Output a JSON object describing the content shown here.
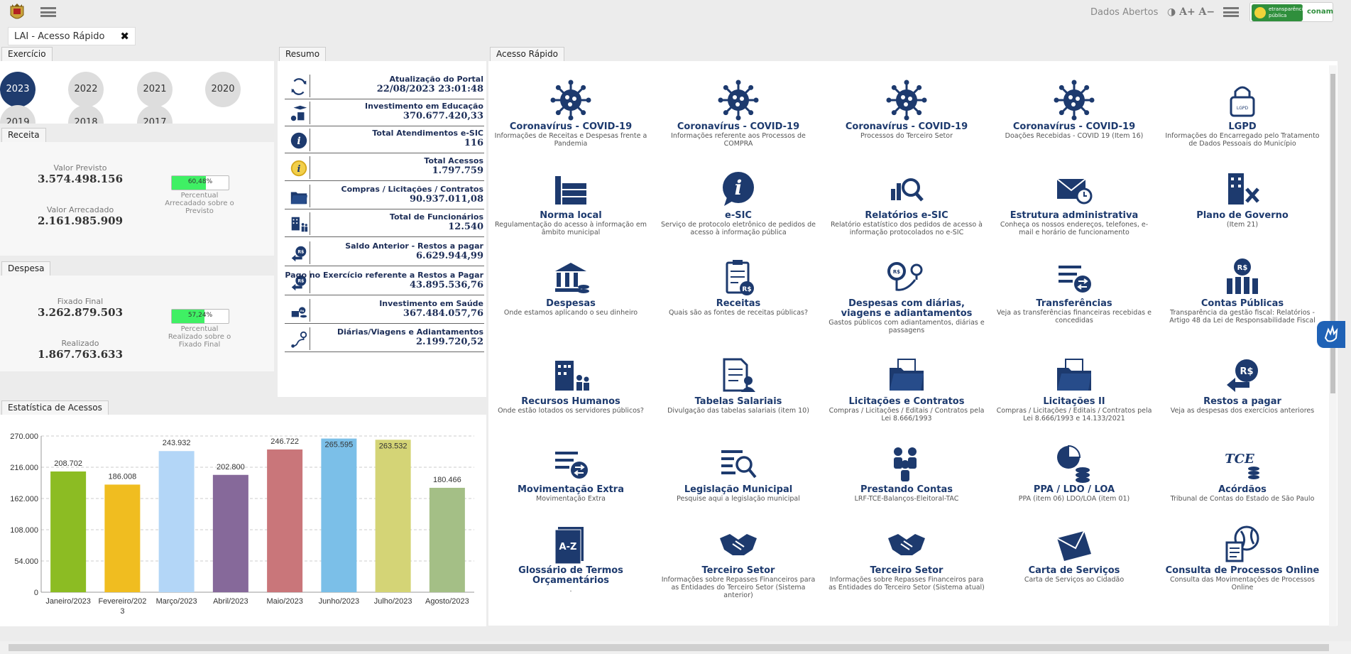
{
  "header": {
    "dados_abertos": "Dados Abertos",
    "font_controls": "◑ A+ A−",
    "brand_text": "etransparência pública",
    "brand_company": "conam"
  },
  "open_tab": {
    "label": "LAI - Acesso Rápido",
    "close": "✖"
  },
  "exercicio": {
    "tab": "Exercício",
    "years": [
      "2023",
      "2022",
      "2021",
      "2020",
      "2019",
      "2018",
      "2017"
    ],
    "selected": "2023"
  },
  "receita": {
    "tab": "Receita",
    "previsto_label": "Valor Previsto",
    "previsto_value": "3.574.498.156",
    "arrecadado_label": "Valor Arrecadado",
    "arrecadado_value": "2.161.985.909",
    "percent_text": "60,48%",
    "percent_value": 60.48,
    "percent_note": "Percentual Arrecadado sobre o Previsto"
  },
  "despesa": {
    "tab": "Despesa",
    "fixado_label": "Fixado Final",
    "fixado_value": "3.262.879.503",
    "realizado_label": "Realizado",
    "realizado_value": "1.867.763.633",
    "percent_text": "57,24%",
    "percent_value": 57.24,
    "percent_note": "Percentual Realizado sobre o Fixado Final"
  },
  "resumo": {
    "tab": "Resumo",
    "rows": [
      {
        "label": "Atualização do Portal",
        "value": "22/08/2023 23:01:48",
        "icon": "refresh-icon"
      },
      {
        "label": "Investimento em Educação",
        "value": "370.677.420,33",
        "icon": "education-icon"
      },
      {
        "label": "Total Atendimentos e-SIC",
        "value": "116",
        "icon": "info-icon"
      },
      {
        "label": "Total Acessos",
        "value": "1.797.759",
        "icon": "info-yellow-icon"
      },
      {
        "label": "Compras / Licitações / Contratos",
        "value": "90.937.011,08",
        "icon": "folder-icon"
      },
      {
        "label": "Total de Funcionários",
        "value": "12.540",
        "icon": "staff-icon"
      },
      {
        "label": "Saldo Anterior - Restos a pagar",
        "value": "6.629.944,99",
        "icon": "money-back-icon"
      },
      {
        "label": "Pago no Exercício referente a Restos a Pagar",
        "value": "43.895.536,76",
        "icon": "money-back-icon"
      },
      {
        "label": "Investimento em Saúde",
        "value": "367.484.057,76",
        "icon": "health-money-icon"
      },
      {
        "label": "Diárias/Viagens e Adiantamentos",
        "value": "2.199.720,52",
        "icon": "route-icon"
      }
    ]
  },
  "acesso_rapido": {
    "tab": "Acesso Rápido",
    "items": [
      {
        "title": "Coronavírus - COVID-19",
        "desc": "Informações de Receitas e Despesas frente a Pandemia",
        "icon": "virus-icon"
      },
      {
        "title": "Coronavírus - COVID-19",
        "desc": "Informações referente aos Processos de COMPRA",
        "icon": "virus-icon"
      },
      {
        "title": "Coronavírus - COVID-19",
        "desc": "Processos do Terceiro Setor",
        "icon": "virus-icon"
      },
      {
        "title": "Coronavírus - COVID-19",
        "desc": "Doações Recebidas - COVID 19 (Item 16)",
        "icon": "virus-icon"
      },
      {
        "title": "LGPD",
        "desc": "Informações do Encarregado pelo Tratamento de Dados Pessoais do Município",
        "icon": "lock-icon"
      },
      {
        "title": "Norma local",
        "desc": "Regulamentação do acesso à informação em âmbito municipal",
        "icon": "books-icon"
      },
      {
        "title": "e-SIC",
        "desc": "Serviço de protocolo eletrônico de pedidos de acesso à informação pública",
        "icon": "info-bubble-icon"
      },
      {
        "title": "Relatórios e-SIC",
        "desc": "Relatório estatístico dos pedidos de acesso à informação protocolados no e-SIC",
        "icon": "chart-search-icon"
      },
      {
        "title": "Estrutura administrativa",
        "desc": "Conheça os nossos endereços, telefones, e-mail e horário de funcionamento",
        "icon": "mail-clock-icon"
      },
      {
        "title": "Plano de Governo",
        "desc": "(Item 21)",
        "icon": "building-tools-icon"
      },
      {
        "title": "Despesas",
        "desc": "Onde estamos aplicando o seu dinheiro",
        "icon": "bank-coins-icon"
      },
      {
        "title": "Receitas",
        "desc": "Quais são as fontes de receitas públicas?",
        "icon": "clipboard-money-icon"
      },
      {
        "title": "Despesas com diárias, viagens e adiantamentos",
        "desc": "Gastos públicos com adiantamentos, diárias e passagens",
        "icon": "route-money-icon"
      },
      {
        "title": "Transferências",
        "desc": "Veja as transferências financeiras recebidas e concedidas",
        "icon": "list-transfer-icon"
      },
      {
        "title": "Contas Públicas",
        "desc": "Transparência da gestão fiscal: Relatórios - Artigo 48 da Lei de Responsabilidade Fiscal",
        "icon": "money-bars-icon"
      },
      {
        "title": "Recursos Humanos",
        "desc": "Onde estão lotados os servidores públicos?",
        "icon": "building-people-icon"
      },
      {
        "title": "Tabelas Salariais",
        "desc": "Divulgação das tabelas salariais (item 10)",
        "icon": "document-person-icon"
      },
      {
        "title": "Licitações e Contratos",
        "desc": "Compras / Licitações / Editais / Contratos pela Lei 8.666/1993",
        "icon": "folder-docs-icon"
      },
      {
        "title": "Licitações II",
        "desc": "Compras / Licitações / Editais / Contratos pela Lei 8.666/1993 e 14.133/2021",
        "icon": "folder-docs-icon"
      },
      {
        "title": "Restos a pagar",
        "desc": "Veja as despesas dos exercícios anteriores",
        "icon": "money-back-icon"
      },
      {
        "title": "Movimentação Extra",
        "desc": "Movimentação Extra",
        "icon": "list-transfer-icon"
      },
      {
        "title": "Legislação Municipal",
        "desc": "Pesquise aqui a legislação municipal",
        "icon": "list-search-icon"
      },
      {
        "title": "Prestando Contas",
        "desc": "LRF-TCE-Balanços-Eleitoral-TAC",
        "icon": "people-group-icon"
      },
      {
        "title": "PPA / LDO / LOA",
        "desc": "PPA (item 06) LDO/LOA (item 01)",
        "icon": "pie-coins-icon"
      },
      {
        "title": "Acórdãos",
        "desc": "Tribunal de Contas do Estado de São Paulo",
        "icon": "tce-icon"
      },
      {
        "title": "Glossário de Termos Orçamentários",
        "desc": ".",
        "icon": "az-book-icon"
      },
      {
        "title": "Terceiro Setor",
        "desc": "Informações sobre Repasses Financeiros para as Entidades do Terceiro Setor (Sistema anterior)",
        "icon": "handshake-icon"
      },
      {
        "title": "Terceiro Setor",
        "desc": "Informações sobre Repasses Financeiros para as Entidades do Terceiro Setor (Sistema atual)",
        "icon": "handshake-icon"
      },
      {
        "title": "Carta de Serviços",
        "desc": "Carta de Serviços ao Cidadão",
        "icon": "envelope-icon"
      },
      {
        "title": "Consulta de Processos Online",
        "desc": "Consulta das Movimentações de Processos Online",
        "icon": "globe-doc-icon"
      }
    ]
  },
  "estatistica": {
    "tab": "Estatística de Acessos"
  },
  "chart_data": {
    "type": "bar",
    "categories": [
      "Janeiro/2023",
      "Fevereiro/2023",
      "Março/2023",
      "Abril/2023",
      "Maio/2023",
      "Junho/2023",
      "Julho/2023",
      "Agosto/2023"
    ],
    "values": [
      208702,
      186008,
      243932,
      202800,
      246722,
      265595,
      263532,
      180466
    ],
    "value_labels": [
      "208.702",
      "186.008",
      "243.932",
      "202.800",
      "246.722",
      "265.595",
      "263.532",
      "180.466"
    ],
    "colors": [
      "#8cbc23",
      "#f0bd20",
      "#b3d6f7",
      "#86699a",
      "#c9767a",
      "#7bbfe8",
      "#d4d476",
      "#a4bf86"
    ],
    "y_ticks": [
      "270.000",
      "216.000",
      "162.000",
      "108.000",
      "54.000",
      "0"
    ],
    "ylim": [
      0,
      270000
    ],
    "grid": true
  }
}
